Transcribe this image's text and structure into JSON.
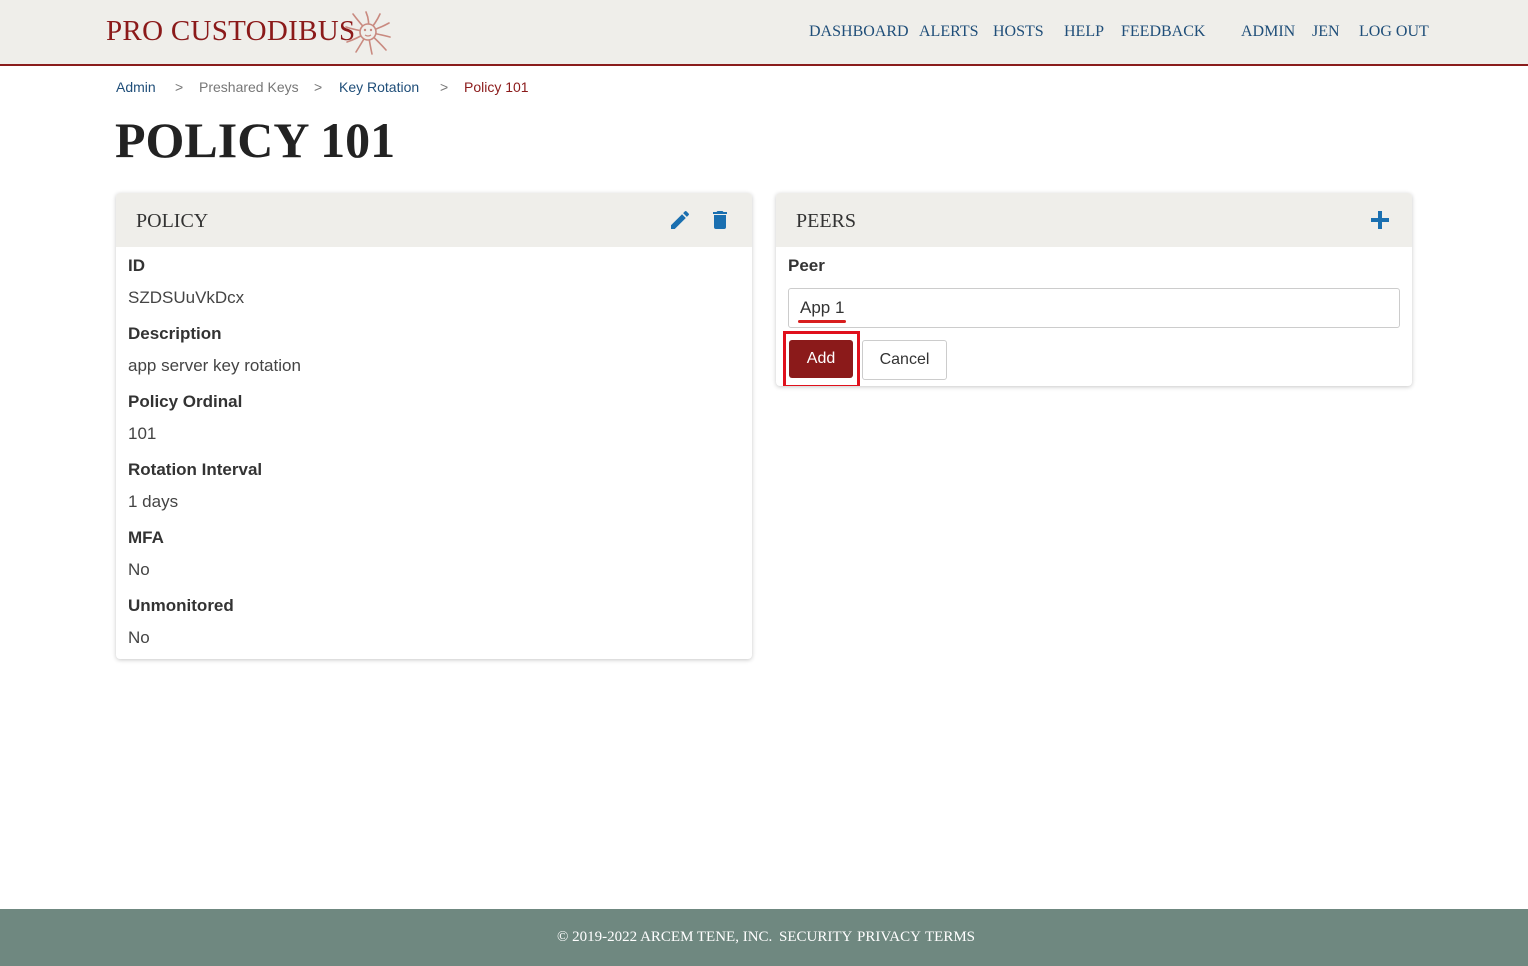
{
  "header": {
    "brand": "PRO CUSTODIBUS",
    "nav": {
      "dashboard": "DASHBOARD",
      "alerts": "ALERTS",
      "hosts": "HOSTS",
      "help": "HELP",
      "feedback": "FEEDBACK",
      "admin": "ADMIN",
      "user": "JEN",
      "logout": "LOG OUT"
    }
  },
  "breadcrumb": {
    "items": [
      "Admin",
      "Preshared Keys",
      "Key Rotation",
      "Policy 101"
    ],
    "separator": ">"
  },
  "page": {
    "title": "POLICY 101"
  },
  "policy_card": {
    "title": "POLICY",
    "fields": [
      {
        "label": "ID",
        "value": "SZDSUuVkDcx"
      },
      {
        "label": "Description",
        "value": "app server key rotation"
      },
      {
        "label": "Policy Ordinal",
        "value": "101"
      },
      {
        "label": "Rotation Interval",
        "value": "1 days"
      },
      {
        "label": "MFA",
        "value": "No"
      },
      {
        "label": "Unmonitored",
        "value": "No"
      }
    ]
  },
  "peers_card": {
    "title": "PEERS",
    "peer_label": "Peer",
    "peer_value": "App 1",
    "add_label": "Add",
    "cancel_label": "Cancel"
  },
  "footer": {
    "copyright": "© 2019-2022 ARCEM TENE, INC.",
    "security": "SECURITY",
    "privacy": "PRIVACY",
    "terms": "TERMS"
  },
  "colors": {
    "brand": "#8b1a1a",
    "nav_link": "#1f4e79",
    "icon": "#1a6fb0",
    "header_bg": "#efeeea",
    "footer_bg": "#6f8880",
    "highlight": "#e0101c"
  },
  "icons": {
    "logo": "medusa-head-icon",
    "edit": "pencil-icon",
    "delete": "trash-icon",
    "add": "plus-icon"
  }
}
